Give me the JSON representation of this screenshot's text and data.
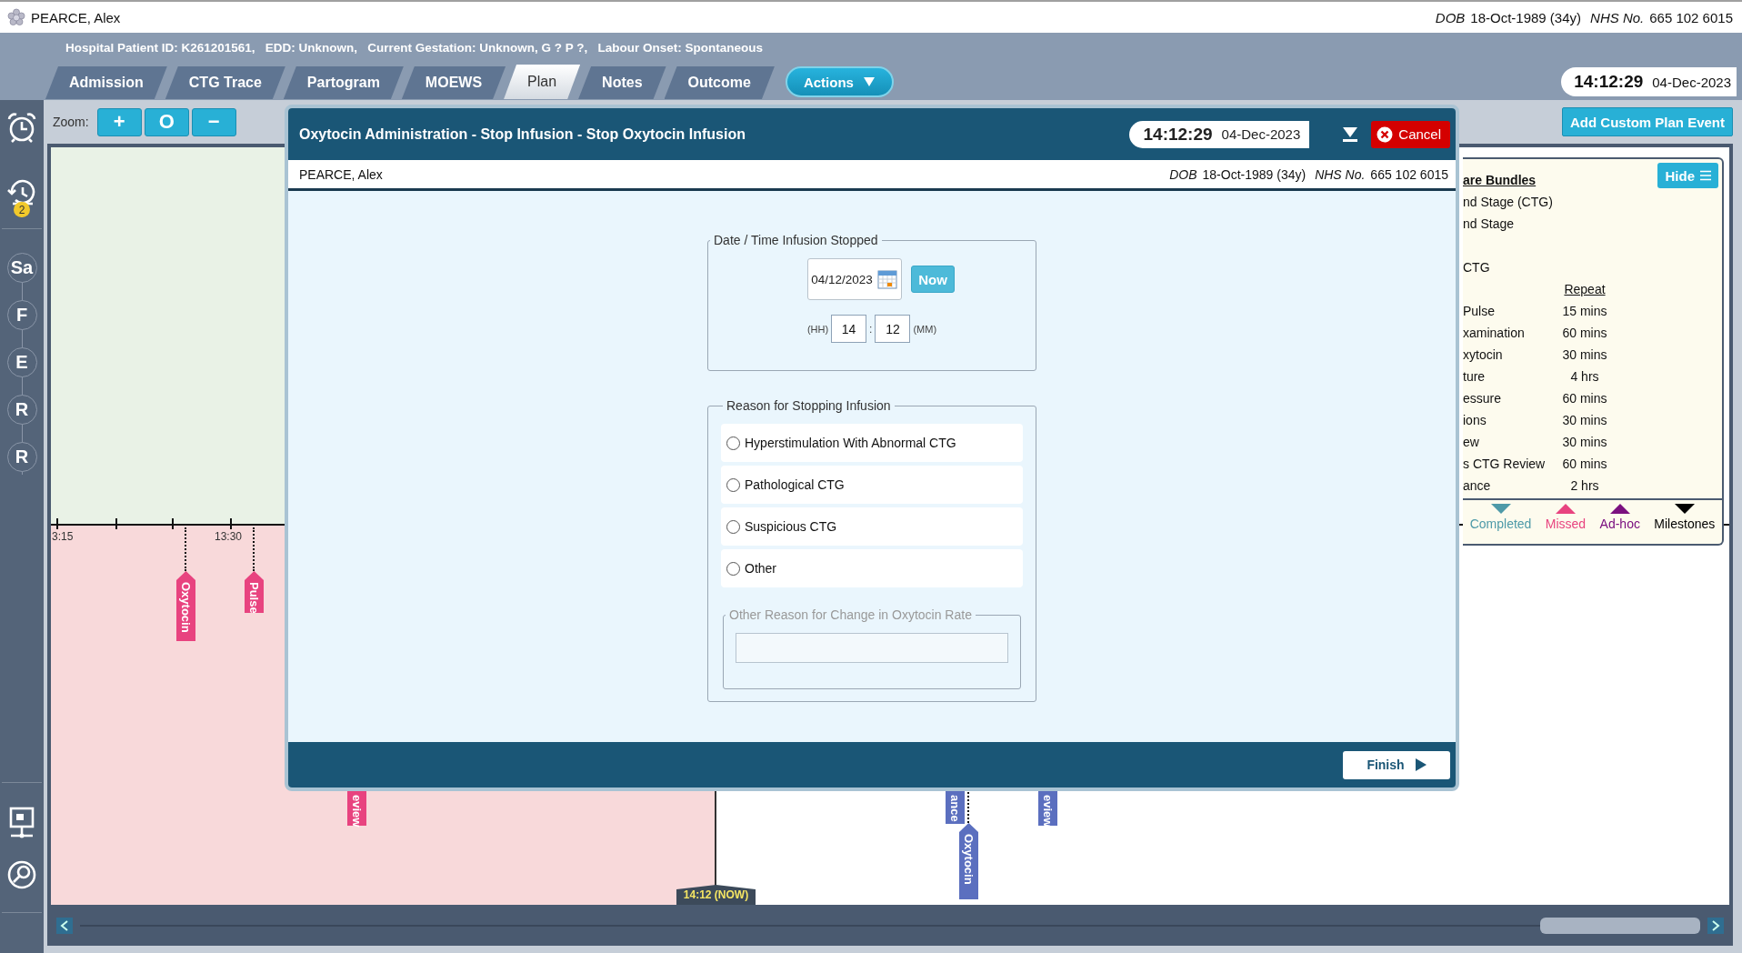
{
  "patient_bar": {
    "name": "PEARCE, Alex",
    "dob_label": "DOB",
    "dob": "18-Oct-1989 (34y)",
    "nhs_label": "NHS No.",
    "nhs": "665 102 6015"
  },
  "header": {
    "info": "Hospital Patient ID: K261201561,   EDD: Unknown,   Current Gestation: Unknown, G ? P ?,   Labour Onset: Spontaneous",
    "tabs": [
      {
        "label": "Admission",
        "selected": false
      },
      {
        "label": "CTG Trace",
        "selected": false
      },
      {
        "label": "Partogram",
        "selected": false
      },
      {
        "label": "MOEWS",
        "selected": false
      },
      {
        "label": "Plan",
        "selected": true
      },
      {
        "label": "Notes",
        "selected": false
      },
      {
        "label": "Outcome",
        "selected": false
      }
    ],
    "actions_button": "Actions",
    "clock": {
      "time": "14:12:29",
      "date": "04-Dec-2023"
    }
  },
  "sidebar": {
    "alert_badge": "2",
    "stages": [
      "Sa",
      "F",
      "E",
      "R",
      "R"
    ]
  },
  "zoom": {
    "label": "Zoom:",
    "buttons": [
      "+",
      "O",
      "−"
    ]
  },
  "add_event_button": "Add Custom Plan Event",
  "timeline": {
    "ticks": [
      "3:15",
      "13:30"
    ],
    "markers": [
      {
        "label": "Oxytocin",
        "color": "#e8437f"
      },
      {
        "label": "Pulse",
        "color": "#e8437f"
      },
      {
        "label": "eview",
        "color": "#e8437f"
      },
      {
        "label": "ance",
        "color": "#5b6fbf"
      },
      {
        "label": "Oxytocin",
        "color": "#5b6fbf"
      },
      {
        "label": "eview",
        "color": "#5b6fbf"
      }
    ],
    "now_label": "14:12 (NOW)"
  },
  "bundles": {
    "title": "are Bundles",
    "hide_button": "Hide",
    "lines": [
      "nd Stage (CTG)",
      "nd Stage",
      "CTG"
    ],
    "repeat_heading": "Repeat",
    "rows": [
      {
        "name": "Pulse",
        "repeat": "15 mins"
      },
      {
        "name": "xamination",
        "repeat": "60 mins"
      },
      {
        "name": "xytocin",
        "repeat": "30 mins"
      },
      {
        "name": "ture",
        "repeat": "4 hrs"
      },
      {
        "name": "essure",
        "repeat": "60 mins"
      },
      {
        "name": "ions",
        "repeat": "30 mins"
      },
      {
        "name": "ew",
        "repeat": "30 mins"
      },
      {
        "name": "s CTG Review",
        "repeat": "60 mins"
      },
      {
        "name": "ance",
        "repeat": "2 hrs"
      }
    ],
    "legend": [
      {
        "label": "Completed",
        "color": "#4e9aa8",
        "kind": "down"
      },
      {
        "label": "Missed",
        "color": "#e8437f",
        "kind": "up"
      },
      {
        "label": "Ad-hoc",
        "color": "#7b1080",
        "kind": "up"
      },
      {
        "label": "Milestones",
        "color": "#000000",
        "kind": "down"
      }
    ]
  },
  "modal": {
    "title": "Oxytocin Administration - Stop Infusion - Stop Oxytocin Infusion",
    "time": "14:12:29",
    "date": "04-Dec-2023",
    "cancel_button": "Cancel",
    "patient": {
      "name": "PEARCE, Alex",
      "dob_label": "DOB",
      "dob": "18-Oct-1989 (34y)",
      "nhs_label": "NHS No.",
      "nhs": "665 102 6015"
    },
    "date_group": {
      "legend": "Date / Time Infusion Stopped",
      "date": "04/12/2023",
      "now_button": "Now",
      "hh_label": "(HH)",
      "hh": "14",
      "separator": ":",
      "mm": "12",
      "mm_label": "(MM)"
    },
    "reason_group": {
      "legend": "Reason for Stopping Infusion",
      "options": [
        {
          "label": "Hyperstimulation With Abnormal CTG",
          "selected": false
        },
        {
          "label": "Pathological CTG",
          "selected": false
        },
        {
          "label": "Suspicious CTG",
          "selected": false
        },
        {
          "label": "Other",
          "selected": false
        }
      ],
      "other": {
        "legend": "Other Reason for Change in Oxytocin Rate",
        "disabled": true
      }
    },
    "finish_button": "Finish"
  }
}
